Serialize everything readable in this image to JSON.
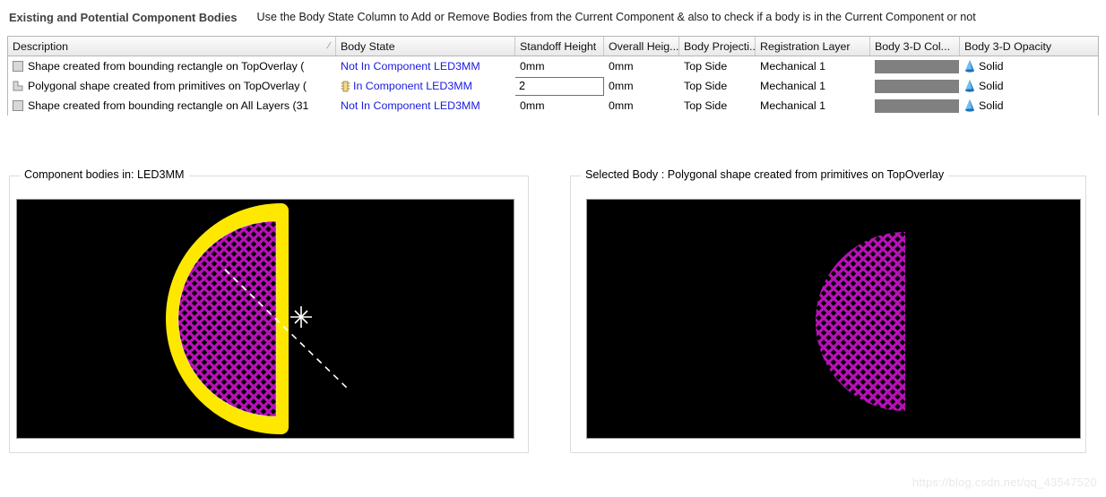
{
  "header": {
    "title": "Existing and Potential Component Bodies",
    "hint": "Use the Body State Column to Add or Remove Bodies from the Current Component & also to check if a body is in the Current Component or not"
  },
  "table": {
    "columns": [
      {
        "key": "description",
        "label": "Description",
        "sort_indicator": "/"
      },
      {
        "key": "body_state",
        "label": "Body State"
      },
      {
        "key": "standoff_height",
        "label": "Standoff Height"
      },
      {
        "key": "overall_height",
        "label": "Overall Heig..."
      },
      {
        "key": "body_projection",
        "label": "Body Projecti..."
      },
      {
        "key": "registration_layer",
        "label": "Registration Layer"
      },
      {
        "key": "body_3d_color",
        "label": "Body 3-D Col..."
      },
      {
        "key": "body_3d_opacity",
        "label": "Body 3-D Opacity"
      }
    ],
    "rows": [
      {
        "icon": "rectangle-shape-icon",
        "description": "Shape created from bounding rectangle on TopOverlay (",
        "state_icon": null,
        "body_state": "Not In Component LED3MM",
        "standoff_height": "0mm",
        "standoff_editable": false,
        "overall_height": "0mm",
        "body_projection": "Top Side",
        "registration_layer": "Mechanical 1",
        "body_3d_color": "#808080",
        "body_3d_opacity": "Solid"
      },
      {
        "icon": "polygon-shape-icon",
        "description": "Polygonal shape created from primitives on TopOverlay (",
        "state_icon": "component-chip-icon",
        "body_state": "In Component LED3MM",
        "standoff_height": "2",
        "standoff_editable": true,
        "overall_height": "0mm",
        "body_projection": "Top Side",
        "registration_layer": "Mechanical 1",
        "body_3d_color": "#808080",
        "body_3d_opacity": "Solid"
      },
      {
        "icon": "rectangle-shape-icon",
        "description": "Shape created from bounding rectangle on All Layers (31",
        "state_icon": null,
        "body_state": "Not In Component LED3MM",
        "standoff_height": "0mm",
        "standoff_editable": false,
        "overall_height": "0mm",
        "body_projection": "Top Side",
        "registration_layer": "Mechanical 1",
        "body_3d_color": "#808080",
        "body_3d_opacity": "Solid"
      }
    ]
  },
  "panels": {
    "left": {
      "label": "Component bodies in: LED3MM",
      "outline_color": "#ffe800",
      "fill_color": "#b000b0",
      "background": "#000000",
      "marker": "crosshair"
    },
    "right": {
      "label": "Selected Body : Polygonal shape created from primitives on TopOverlay",
      "fill_color": "#b000b0",
      "background": "#000000"
    }
  },
  "watermark": "https://blog.csdn.net/qq_43547520"
}
